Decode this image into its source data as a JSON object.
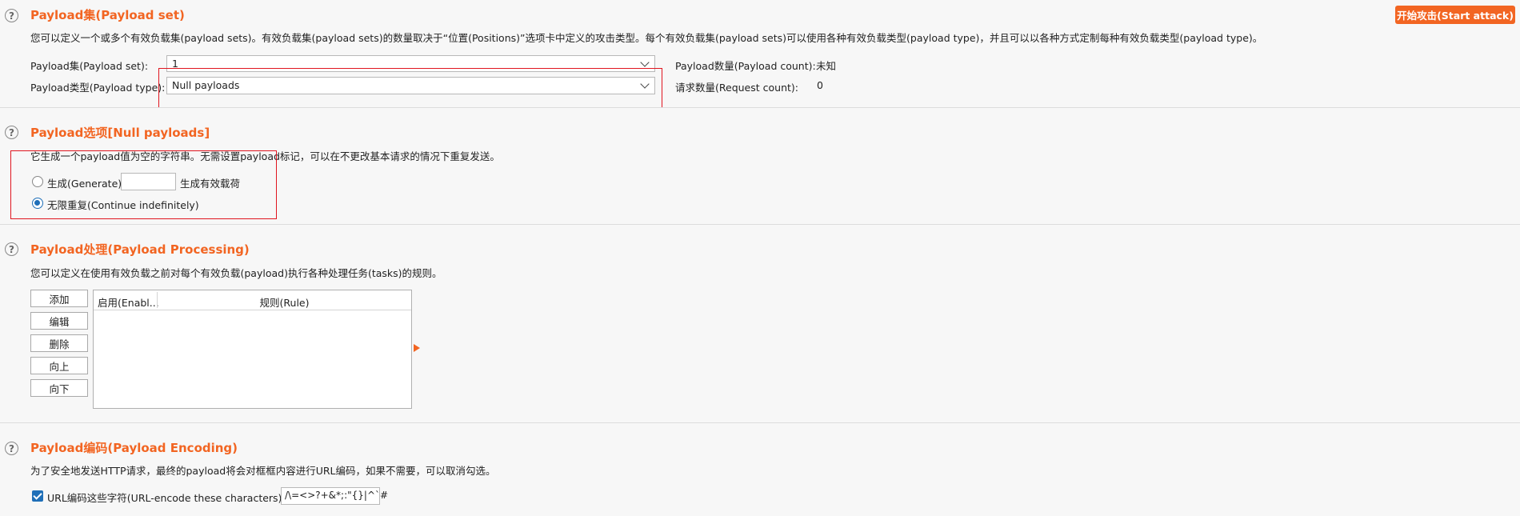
{
  "actions": {
    "start_attack": "开始攻击(Start attack)"
  },
  "payload_set": {
    "title": "Payload集(Payload set)",
    "description": "您可以定义一个或多个有效负载集(payload sets)。有效负载集(payload sets)的数量取决于“位置(Positions)”选项卡中定义的攻击类型。每个有效负载集(payload sets)可以使用各种有效负载类型(payload type)，并且可以以各种方式定制每种有效负载类型(payload type)。",
    "set_label": "Payload集(Payload set):",
    "set_value": "1",
    "type_label": "Payload类型(Payload type):",
    "type_value": "Null payloads",
    "count_label": "Payload数量(Payload count):",
    "count_value": "未知",
    "request_label": "请求数量(Request count):",
    "request_value": "0"
  },
  "payload_options": {
    "title": "Payload选项[Null payloads]",
    "description": "它生成一个payload值为空的字符串。无需设置payload标记，可以在不更改基本请求的情况下重复发送。",
    "generate_label": "生成(Generate)",
    "generate_value": "",
    "generate_suffix": "生成有效载荷",
    "continue_label": "无限重复(Continue indefinitely)",
    "selected": "continue"
  },
  "payload_processing": {
    "title": "Payload处理(Payload Processing)",
    "description": "您可以定义在使用有效负载之前对每个有效负载(payload)执行各种处理任务(tasks)的规则。",
    "buttons": {
      "add": "添加",
      "edit": "编辑",
      "remove": "删除",
      "up": "向上",
      "down": "向下"
    },
    "columns": {
      "enabled": "启用(Enabl...",
      "rule": "规则(Rule)"
    },
    "rows": []
  },
  "payload_encoding": {
    "title": "Payload编码(Payload Encoding)",
    "description": "为了安全地发送HTTP请求，最终的payload将会对框框内容进行URL编码，如果不需要，可以取消勾选。",
    "urlencode_label": "URL编码这些字符(URL-encode these characters):",
    "urlencode_checked": true,
    "urlencode_chars": "/\\=<>?+&*;:\"{}|^`#"
  },
  "colors": {
    "accent": "#f26522",
    "highlight_box": "#e0151f",
    "control_blue": "#1f6fb8"
  }
}
